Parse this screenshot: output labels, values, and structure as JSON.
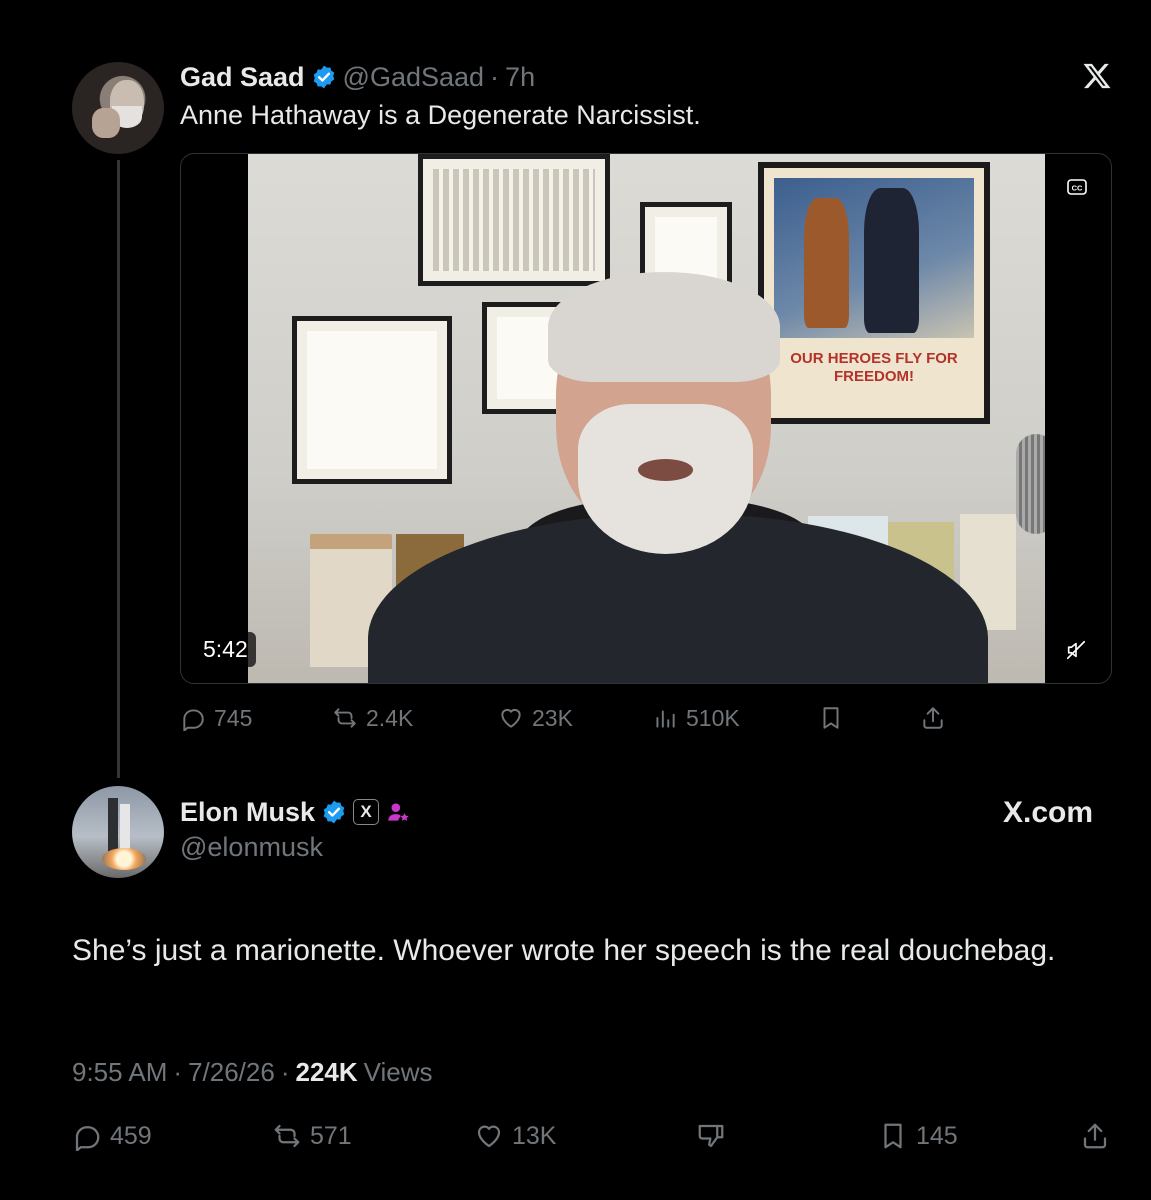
{
  "original_tweet": {
    "author_name": "Gad Saad",
    "author_handle": "@GadSaad",
    "separator": "·",
    "time": "7h",
    "text": "Anne Hathaway is a Degenerate Narcissist.",
    "video": {
      "duration": "5:42",
      "poster_text": "OUR HEROES FLY FOR FREEDOM!"
    },
    "stats": {
      "replies": "745",
      "reposts": "2.4K",
      "likes": "23K",
      "views": "510K"
    }
  },
  "reply_tweet": {
    "author_name": "Elon Musk",
    "author_handle": "@elonmusk",
    "site_label": "X.com",
    "badge_letter": "X",
    "text": "She’s just a marionette. Whoever wrote her speech is the real douchebag.",
    "timestamp": "9:55 AM",
    "date": "7/26/26",
    "separator": "·",
    "views_count": "224K",
    "views_label": "Views",
    "stats": {
      "replies": "459",
      "reposts": "571",
      "likes": "13K",
      "bookmarks": "145"
    }
  },
  "colors": {
    "background": "#000000",
    "text_primary": "#e7e9ea",
    "text_secondary": "#71767b",
    "verified_blue": "#1d9bf0",
    "affiliate_purple": "#c936cc"
  },
  "icons": {
    "verified": "verified-badge-icon",
    "x_logo": "x-logo-icon",
    "reply": "reply-icon",
    "repost": "repost-icon",
    "like": "heart-icon",
    "views": "views-bars-icon",
    "bookmark": "bookmark-icon",
    "share": "share-icon",
    "downvote": "thumbs-down-icon",
    "captions": "cc-icon",
    "mute": "mute-icon"
  }
}
